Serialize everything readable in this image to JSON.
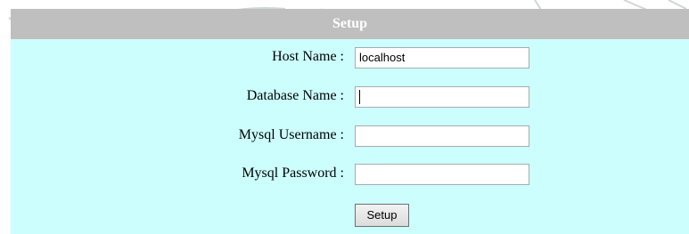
{
  "setup": {
    "title": "Setup",
    "fields": [
      {
        "label": "Host Name :",
        "value": "localhost"
      },
      {
        "label": "Database Name :",
        "value": ""
      },
      {
        "label": "Mysql Username :",
        "value": ""
      },
      {
        "label": "Mysql Password :",
        "value": ""
      }
    ],
    "submit_label": "Setup"
  },
  "colors": {
    "panel_background": "#ccfefe",
    "title_bar": "#bfbfbf",
    "title_text": "#ffffff"
  },
  "icons": {
    "watermark": "elephant-seal-watermark-icon",
    "ornament": "flower-ornament-icon"
  }
}
